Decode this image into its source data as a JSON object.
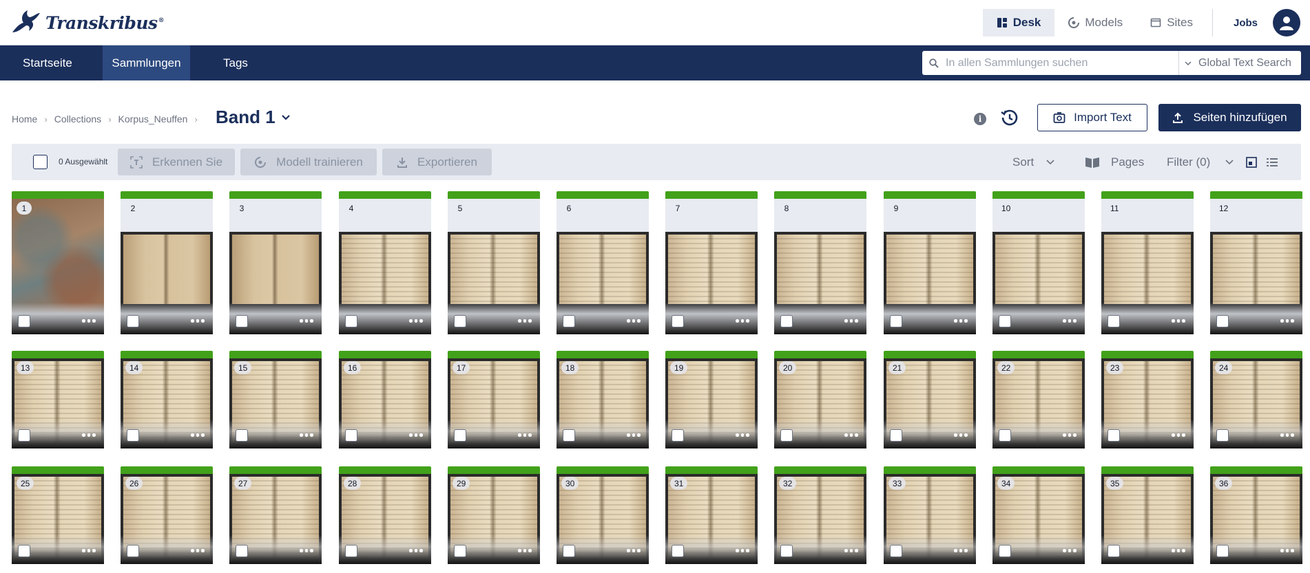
{
  "app": {
    "logo_text": "Transkribus",
    "logo_mark": "®"
  },
  "topnav": {
    "desk": "Desk",
    "models": "Models",
    "sites": "Sites",
    "jobs": "Jobs"
  },
  "mainnav": {
    "tabs": [
      "Startseite",
      "Sammlungen",
      "Tags"
    ],
    "active_tab": "Sammlungen",
    "search_placeholder": "In allen Sammlungen suchen",
    "search_mode": "Global Text Search"
  },
  "breadcrumb": {
    "items": [
      "Home",
      "Collections",
      "Korpus_Neuffen"
    ],
    "current": "Band 1"
  },
  "actions": {
    "import_text": "Import Text",
    "add_pages": "Seiten hinzufügen"
  },
  "toolbar": {
    "selected_count": "0 Ausgewählt",
    "recognize": "Erkennen Sie",
    "train_model": "Modell trainieren",
    "export": "Exportieren",
    "sort": "Sort",
    "pages": "Pages",
    "filter": "Filter (0)"
  },
  "pages": [
    "1",
    "2",
    "3",
    "4",
    "5",
    "6",
    "7",
    "8",
    "9",
    "10",
    "11",
    "12",
    "13",
    "14",
    "15",
    "16",
    "17",
    "18",
    "19",
    "20",
    "21",
    "22",
    "23",
    "24",
    "25",
    "26",
    "27",
    "28",
    "29",
    "30",
    "31",
    "32",
    "33",
    "34",
    "35",
    "36"
  ],
  "colors": {
    "brand": "#1b2f5b",
    "status_done": "#42a11a"
  }
}
